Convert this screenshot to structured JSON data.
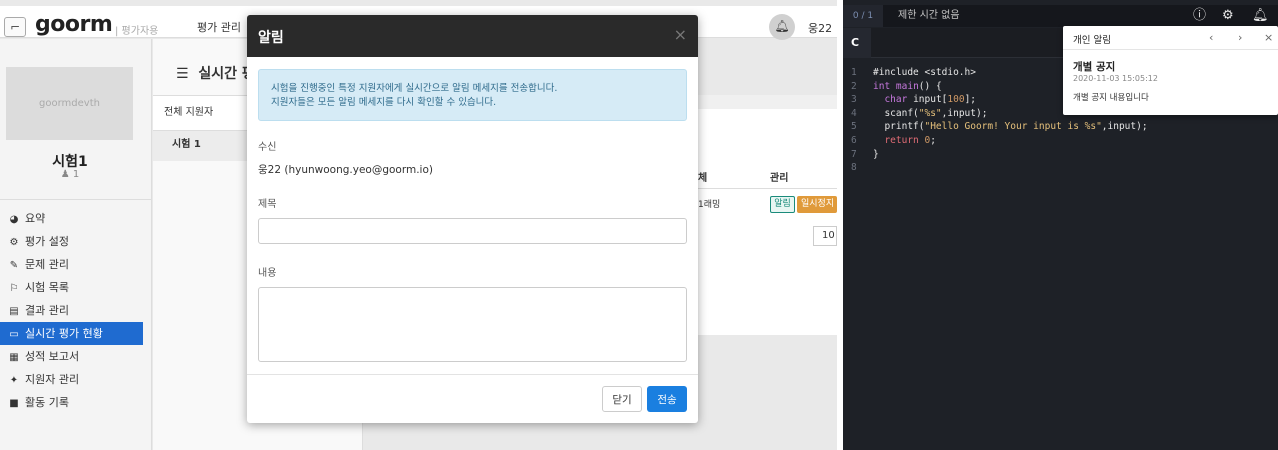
{
  "left": {
    "logo": "goorm",
    "logo_sub": "| 평가자용",
    "top_nav": "평가 관리",
    "user_short": "웅22",
    "profile_image_text": "goormdevth",
    "exam_name": "시험1",
    "exam_count": "1",
    "menu": [
      {
        "label": "요약",
        "icon": "◕"
      },
      {
        "label": "평가 설정",
        "icon": "⚙"
      },
      {
        "label": "문제 관리",
        "icon": "✎"
      },
      {
        "label": "시험 목록",
        "icon": "⚐"
      },
      {
        "label": "결과 관리",
        "icon": "▤"
      },
      {
        "label": "실시간 평가 현황",
        "icon": "▭"
      },
      {
        "label": "성적 보고서",
        "icon": "▦"
      },
      {
        "label": "지원자 관리",
        "icon": "✦"
      },
      {
        "label": "활동 기록",
        "icon": "■"
      }
    ],
    "col2_title": "실시간 평",
    "col2_head": "전체 지원자",
    "col2_row": "시험 1",
    "table_header_partial": "체",
    "table_header_manage": "관리",
    "row_cell_partial": "1래밍",
    "badge_notify": "알림",
    "badge_pause": "일시정지",
    "page_size": "10"
  },
  "modal": {
    "title": "알림",
    "close": "×",
    "info_line1": "시험을 진행중인 특정 지원자에게 실시간으로 알림 메세지를 전송합니다.",
    "info_line2": "지원자들은 모든 알림 메세지를 다시 확인할 수 있습니다.",
    "recipient_label": "수신",
    "recipient_value": "웅22 (hyunwoong.yeo@goorm.io)",
    "subject_label": "제목",
    "subject_value": "",
    "content_label": "내용",
    "content_value": "",
    "close_button": "닫기",
    "send_button": "전송"
  },
  "editor": {
    "counter": "0 / 1",
    "time_text": "제한 시간 없음",
    "tab_label": "C",
    "code_lines": [
      "#include <stdio.h>",
      "int main() {",
      "  char input[100];",
      "  scanf(\"%s\",input);",
      "  printf(\"Hello Goorm! Your input is %s\",input);",
      "  return 0;",
      "}",
      ""
    ],
    "line_numbers": [
      "1",
      "2",
      "3",
      "4",
      "5",
      "6",
      "7",
      "8"
    ],
    "notification": {
      "title": "개인 알림",
      "subject": "개별 공지",
      "date": "2020-11-03 15:05:12",
      "body": "개별 공지 내용입니다"
    }
  }
}
